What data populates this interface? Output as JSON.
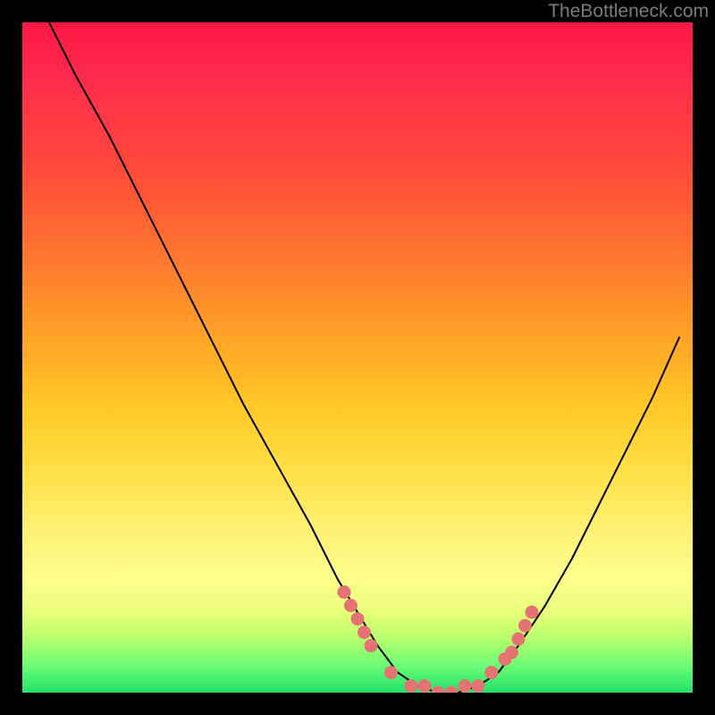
{
  "attribution": "TheBottleneck.com",
  "colors": {
    "frame": "#000000",
    "attribution_text": "#7a7a7a",
    "curve": "#000000",
    "dots": "#e57373",
    "gradient_top": "#ff1744",
    "gradient_mid": "#ffe24a",
    "gradient_bottom": "#23e06a"
  },
  "chart_data": {
    "type": "line",
    "title": "",
    "xlabel": "",
    "ylabel": "",
    "x_range": [
      0,
      100
    ],
    "y_range_percent_bottleneck": [
      0,
      100
    ],
    "note": "V-shaped bottleneck curve. y=0 (bottom/green) is optimal, y=100 (top/red) is severe bottleneck. Curve minimum around x≈57–68. Dots mark near-optimal region along the curve.",
    "curve_points": [
      {
        "x": 4,
        "y": 100
      },
      {
        "x": 8,
        "y": 92
      },
      {
        "x": 13,
        "y": 83
      },
      {
        "x": 18,
        "y": 73
      },
      {
        "x": 23,
        "y": 63
      },
      {
        "x": 28,
        "y": 53
      },
      {
        "x": 33,
        "y": 43
      },
      {
        "x": 38,
        "y": 34
      },
      {
        "x": 43,
        "y": 25
      },
      {
        "x": 47,
        "y": 17
      },
      {
        "x": 50,
        "y": 12
      },
      {
        "x": 53,
        "y": 7
      },
      {
        "x": 56,
        "y": 3
      },
      {
        "x": 59,
        "y": 1
      },
      {
        "x": 62,
        "y": 0
      },
      {
        "x": 65,
        "y": 0
      },
      {
        "x": 68,
        "y": 1
      },
      {
        "x": 71,
        "y": 3
      },
      {
        "x": 74,
        "y": 7
      },
      {
        "x": 78,
        "y": 13
      },
      {
        "x": 82,
        "y": 20
      },
      {
        "x": 86,
        "y": 28
      },
      {
        "x": 90,
        "y": 36
      },
      {
        "x": 94,
        "y": 44
      },
      {
        "x": 98,
        "y": 53
      }
    ],
    "dot_points": [
      {
        "x": 48,
        "y": 15
      },
      {
        "x": 49,
        "y": 13
      },
      {
        "x": 50,
        "y": 11
      },
      {
        "x": 51,
        "y": 9
      },
      {
        "x": 52,
        "y": 7
      },
      {
        "x": 55,
        "y": 3
      },
      {
        "x": 58,
        "y": 1
      },
      {
        "x": 60,
        "y": 1
      },
      {
        "x": 62,
        "y": 0
      },
      {
        "x": 64,
        "y": 0
      },
      {
        "x": 66,
        "y": 1
      },
      {
        "x": 68,
        "y": 1
      },
      {
        "x": 70,
        "y": 3
      },
      {
        "x": 72,
        "y": 5
      },
      {
        "x": 73,
        "y": 6
      },
      {
        "x": 74,
        "y": 8
      },
      {
        "x": 75,
        "y": 10
      },
      {
        "x": 76,
        "y": 12
      }
    ]
  }
}
